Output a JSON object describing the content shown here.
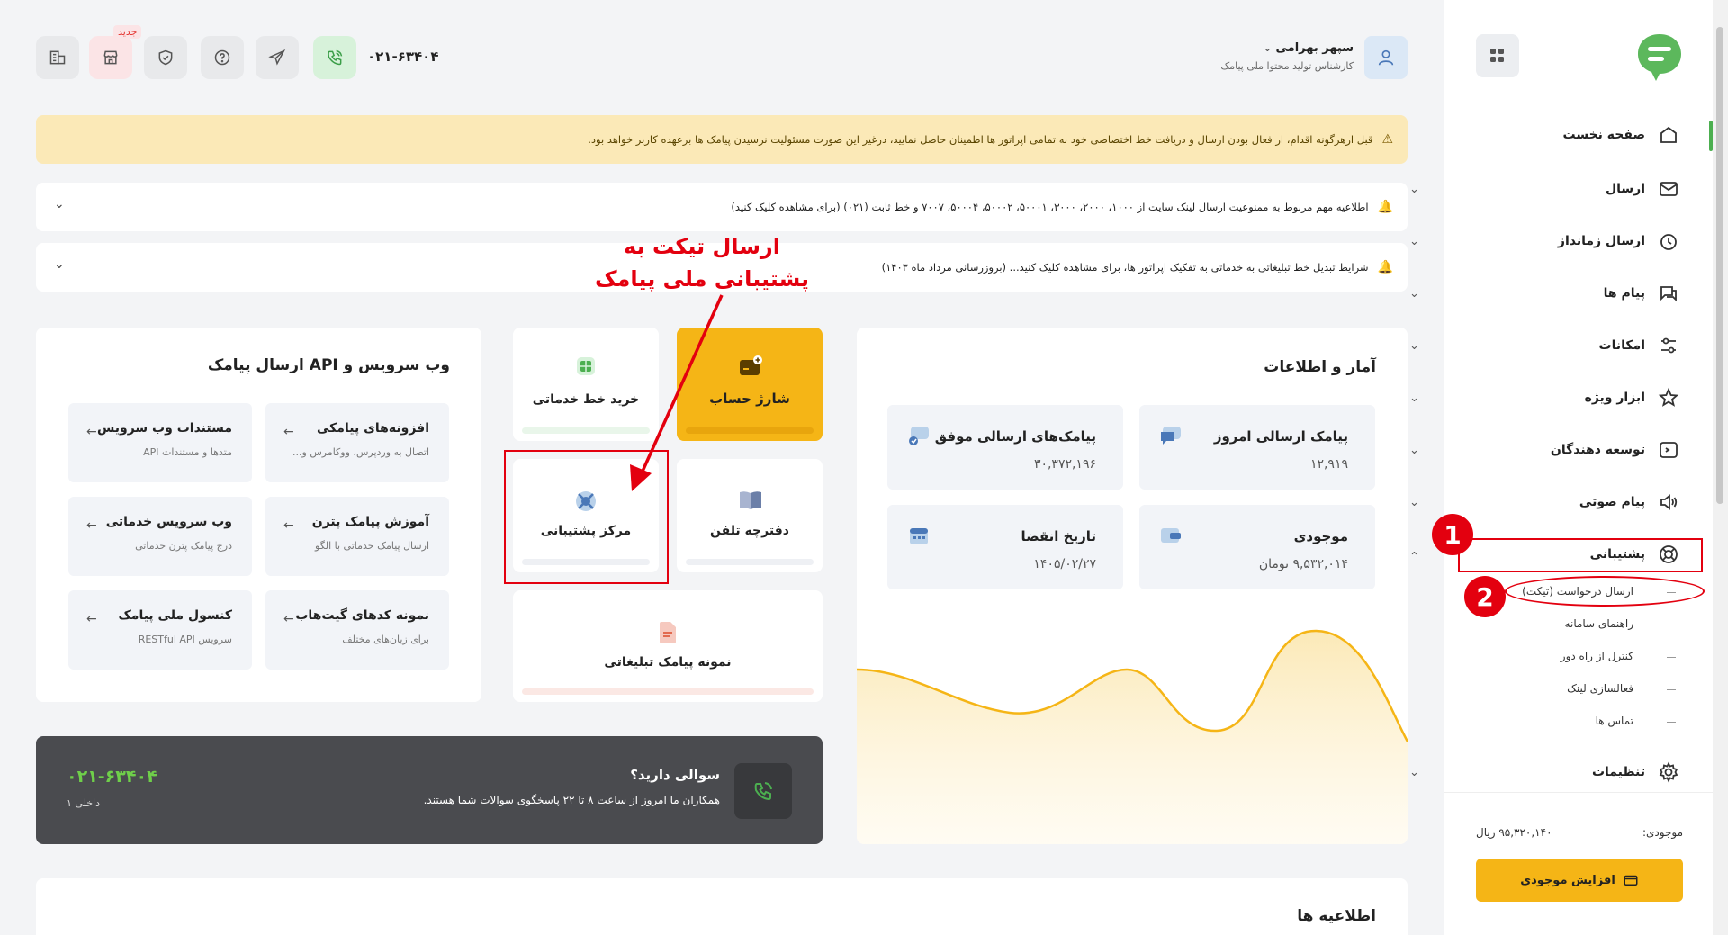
{
  "header": {
    "user_name": "سپهر بهرامی",
    "user_role": "کارشناس تولید محتوا ملی پیامک",
    "phone": "۰۲۱-۶۳۴۰۴",
    "new_badge": "جدید"
  },
  "alerts": {
    "warning_text": "قبل ازهرگونه اقدام، از فعال بودن ارسال و دریافت خط اختصاصی خود به تمامی اپراتور ها اطمینان حاصل نمایید، درغیر این صورت مسئولیت نرسیدن پیامک ها برعهده کاربر خواهد بود.",
    "notice1": "اطلاعیه مهم مربوط به ممنوعیت ارسال لینک سایت از ۱۰۰۰، ۲۰۰۰، ۳۰۰۰، ۵۰۰۰۱، ۵۰۰۰۲، ۵۰۰۰۴، ۷۰۰۷ و خط ثابت (۰۲۱) (برای مشاهده کلیک کنید)",
    "notice2": "شرایط تبدیل خط تبلیغاتی به خدماتی به تفکیک اپراتور ها، برای مشاهده کلیک کنید... (بروزرسانی مرداد ماه ۱۴۰۳)"
  },
  "annotation": {
    "line1": "ارسال تیکت به",
    "line2": "پشتیبانی ملی پیامک",
    "num1": "1",
    "num2": "2"
  },
  "api_section": {
    "title": "وب سرویس و API ارسال پیامک",
    "tiles": [
      {
        "title": "افزونه‌های پیامکی",
        "subtitle": "اتصال به وردپرس، ووکامرس و..."
      },
      {
        "title": "مستندات وب سرویس",
        "subtitle": "متدها و مستندات API"
      },
      {
        "title": "آموزش پیامک پترن",
        "subtitle": "ارسال پیامک خدماتی با الگو"
      },
      {
        "title": "وب سرویس خدماتی",
        "subtitle": "درج پیامک پترن خدماتی"
      },
      {
        "title": "نمونه کدهای گیت‌هاب",
        "subtitle": "برای زبان‌های مختلف"
      },
      {
        "title": "کنسول ملی پیامک",
        "subtitle": "سرویس RESTful API"
      }
    ]
  },
  "actions": {
    "charge": "شارژ حساب",
    "buy_line": "خرید خط خدماتی",
    "phonebook": "دفترچه تلفن",
    "support": "مرکز پشتیبانی",
    "sample": "نمونه پیامک تبلیغاتی"
  },
  "stats": {
    "title": "آمار و اطلاعات",
    "today_label": "پیامک ارسالی امروز",
    "today_value": "۱۲,۹۱۹",
    "success_label": "پیامک‌های ارسالی موفق",
    "success_value": "۳۰,۳۷۲,۱۹۶",
    "balance_label": "موجودی",
    "balance_value": "۹,۵۳۲,۰۱۴ تومان",
    "expire_label": "تاریخ انقضا",
    "expire_value": "۱۴۰۵/۰۲/۲۷"
  },
  "question_box": {
    "title": "سوالی دارید؟",
    "subtitle": "همکاران ما امروز از ساعت ۸ تا ۲۲ پاسخگوی سوالات شما هستند.",
    "phone": "۰۲۱-۶۳۴۰۴",
    "ext": "داخلی ۱"
  },
  "news": {
    "title": "اطلاعیه ها"
  },
  "sidebar": {
    "items": [
      {
        "label": "صفحه نخست"
      },
      {
        "label": "ارسال"
      },
      {
        "label": "ارسال زمانداز"
      },
      {
        "label": "پیام ها"
      },
      {
        "label": "امکانات"
      },
      {
        "label": "ابزار ویژه"
      },
      {
        "label": "توسعه دهندگان"
      },
      {
        "label": "پیام صوتی"
      },
      {
        "label": "پشتیبانی"
      },
      {
        "label": "تنظیمات"
      }
    ],
    "sub_items": [
      {
        "label": "ارسال درخواست (تیکت)"
      },
      {
        "label": "راهنمای سامانه"
      },
      {
        "label": "کنترل از راه دور"
      },
      {
        "label": "فعالسازی لینک"
      },
      {
        "label": "تماس ها"
      }
    ],
    "balance_label": "موجودی:",
    "balance_value": "۹۵,۳۲۰,۱۴۰ ریال",
    "increase_button": "افزایش موجودی"
  },
  "colors": {
    "accent": "#f5b516",
    "brand": "#4caf50",
    "annotation": "#e3000f"
  }
}
